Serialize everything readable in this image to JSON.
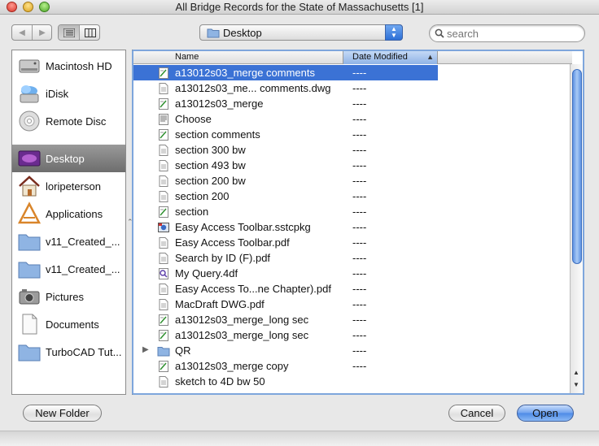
{
  "window": {
    "title": "All Bridge Records for the State of Massachusetts [1]"
  },
  "toolbar": {
    "back_glyph": "◀",
    "forward_glyph": "▶",
    "location": "Desktop",
    "search_placeholder": "search"
  },
  "sidebar": {
    "items": [
      {
        "label": "Macintosh HD",
        "icon": "hard-drive-icon"
      },
      {
        "label": "iDisk",
        "icon": "idisk-icon"
      },
      {
        "label": "Remote Disc",
        "icon": "disc-icon"
      },
      {
        "label": "Desktop",
        "icon": "desktop-icon",
        "selected": true
      },
      {
        "label": "loripeterson",
        "icon": "home-icon"
      },
      {
        "label": "Applications",
        "icon": "applications-icon"
      },
      {
        "label": "v11_Created_...",
        "icon": "folder-icon"
      },
      {
        "label": "v11_Created_...",
        "icon": "folder-icon"
      },
      {
        "label": "Pictures",
        "icon": "camera-icon"
      },
      {
        "label": "Documents",
        "icon": "document-icon"
      },
      {
        "label": "TurboCAD Tut...",
        "icon": "folder-icon"
      }
    ]
  },
  "filelist": {
    "columns": {
      "name": "Name",
      "date": "Date Modified"
    },
    "rows": [
      {
        "name": "a13012s03_merge comments",
        "date": "----",
        "icon": "drawing-file-icon",
        "selected": true
      },
      {
        "name": "a13012s03_me... comments.dwg",
        "date": "----",
        "icon": "document-file-icon"
      },
      {
        "name": "a13012s03_merge",
        "date": "----",
        "icon": "drawing-file-icon"
      },
      {
        "name": "Choose",
        "date": "----",
        "icon": "text-file-icon"
      },
      {
        "name": "section comments",
        "date": "----",
        "icon": "drawing-file-icon"
      },
      {
        "name": "section 300 bw",
        "date": "----",
        "icon": "document-file-icon"
      },
      {
        "name": "section 493 bw",
        "date": "----",
        "icon": "document-file-icon"
      },
      {
        "name": "section 200 bw",
        "date": "----",
        "icon": "document-file-icon"
      },
      {
        "name": "section 200",
        "date": "----",
        "icon": "document-file-icon"
      },
      {
        "name": "section",
        "date": "----",
        "icon": "drawing-file-icon"
      },
      {
        "name": "Easy Access Toolbar.sstcpkg",
        "date": "----",
        "icon": "package-file-icon"
      },
      {
        "name": "Easy Access Toolbar.pdf",
        "date": "----",
        "icon": "document-file-icon"
      },
      {
        "name": "Search by ID (F).pdf",
        "date": "----",
        "icon": "document-file-icon"
      },
      {
        "name": "My Query.4df",
        "date": "----",
        "icon": "query-file-icon"
      },
      {
        "name": "Easy Access To...ne Chapter).pdf",
        "date": "----",
        "icon": "document-file-icon"
      },
      {
        "name": "MacDraft DWG.pdf",
        "date": "----",
        "icon": "document-file-icon"
      },
      {
        "name": "a13012s03_merge_long sec",
        "date": "----",
        "icon": "drawing-file-icon"
      },
      {
        "name": "a13012s03_merge_long sec",
        "date": "----",
        "icon": "drawing-file-icon"
      },
      {
        "name": "QR",
        "date": "----",
        "icon": "folder-icon",
        "folder": true
      },
      {
        "name": "a13012s03_merge copy",
        "date": "----",
        "icon": "drawing-file-icon"
      },
      {
        "name": "sketch to 4D bw 50",
        "date": "",
        "icon": "document-file-icon"
      }
    ]
  },
  "buttons": {
    "new_folder": "New Folder",
    "cancel": "Cancel",
    "open": "Open"
  }
}
